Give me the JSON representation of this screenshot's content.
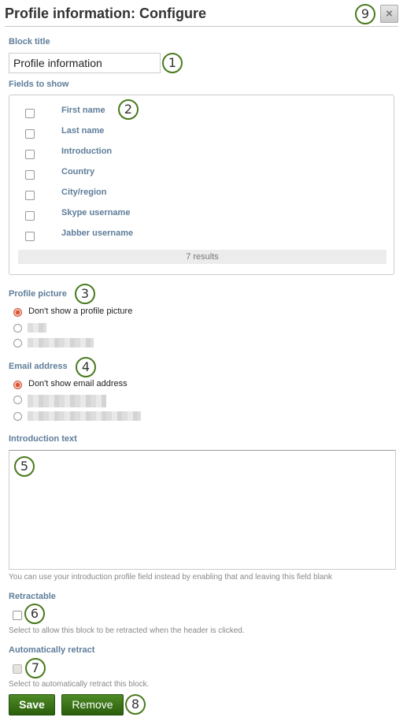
{
  "header": {
    "title": "Profile information: Configure",
    "close_icon": "×"
  },
  "block_title": {
    "label": "Block title",
    "value": "Profile information"
  },
  "fields_to_show": {
    "label": "Fields to show",
    "items": [
      {
        "label": "First name",
        "checked": false
      },
      {
        "label": "Last name",
        "checked": false
      },
      {
        "label": "Introduction",
        "checked": false
      },
      {
        "label": "Country",
        "checked": false
      },
      {
        "label": "City/region",
        "checked": false
      },
      {
        "label": "Skype username",
        "checked": false
      },
      {
        "label": "Jabber username",
        "checked": false
      }
    ],
    "results": "7 results"
  },
  "profile_picture": {
    "label": "Profile picture",
    "options": [
      {
        "label": "Don't show a profile picture",
        "checked": true
      },
      {
        "label": "",
        "checked": false,
        "obscured": true
      },
      {
        "label": "",
        "checked": false,
        "obscured": true
      }
    ]
  },
  "email_address": {
    "label": "Email address",
    "options": [
      {
        "label": "Don't show email address",
        "checked": true
      },
      {
        "label": "",
        "checked": false,
        "obscured": true
      },
      {
        "label": "",
        "checked": false,
        "obscured": true
      }
    ]
  },
  "introduction_text": {
    "label": "Introduction text",
    "value": "",
    "help": "You can use your introduction profile field instead by enabling that and leaving this field blank"
  },
  "retractable": {
    "label": "Retractable",
    "checked": false,
    "help": "Select to allow this block to be retracted when the header is clicked."
  },
  "auto_retract": {
    "label": "Automatically retract",
    "checked": false,
    "disabled": true,
    "help": "Select to automatically retract this block."
  },
  "buttons": {
    "save": "Save",
    "remove": "Remove"
  },
  "callouts": [
    "1",
    "2",
    "3",
    "4",
    "5",
    "6",
    "7",
    "8",
    "9"
  ],
  "colors": {
    "label": "#5e7d9a",
    "button": "#3a7018",
    "callout": "#4a7a1d",
    "radio_checked": "#d9553a"
  }
}
